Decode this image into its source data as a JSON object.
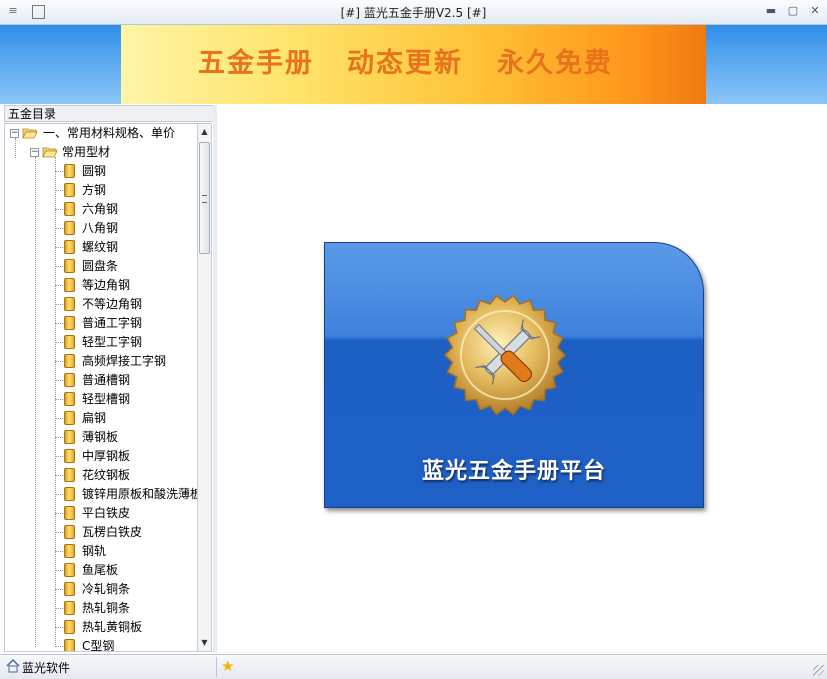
{
  "window": {
    "title": "[#] 蓝光五金手册V2.5 [#]"
  },
  "banner": {
    "slogans": [
      "五金手册",
      "动态更新",
      "永久免费"
    ]
  },
  "left_panel": {
    "header": "五金目录",
    "tree": {
      "root_label": "一、常用材料规格、单价",
      "group_label": "常用型材",
      "items": [
        "圆钢",
        "方钢",
        "六角钢",
        "八角钢",
        "螺纹钢",
        "圆盘条",
        "等边角钢",
        "不等边角钢",
        "普通工字钢",
        "轻型工字钢",
        "高频焊接工字钢",
        "普通槽钢",
        "轻型槽钢",
        "扁钢",
        "薄钢板",
        "中厚钢板",
        "花纹钢板",
        "镀锌用原板和酸洗薄板",
        "平白铁皮",
        "瓦楞白铁皮",
        "钢轨",
        "鱼尾板",
        "冷轧铜条",
        "热轧铜条",
        "热轧黄铜板",
        "C型钢"
      ]
    }
  },
  "main": {
    "card_title": "蓝光五金手册平台"
  },
  "statusbar": {
    "label": "蓝光软件"
  },
  "colors": {
    "card_blue": "#1f60c6",
    "banner_orange": "#e8731a",
    "banner_sky": "#2f8de8"
  },
  "icons": {
    "home": "home-icon",
    "star": "star-icon",
    "tools": "wrench-screwdriver-icon"
  }
}
